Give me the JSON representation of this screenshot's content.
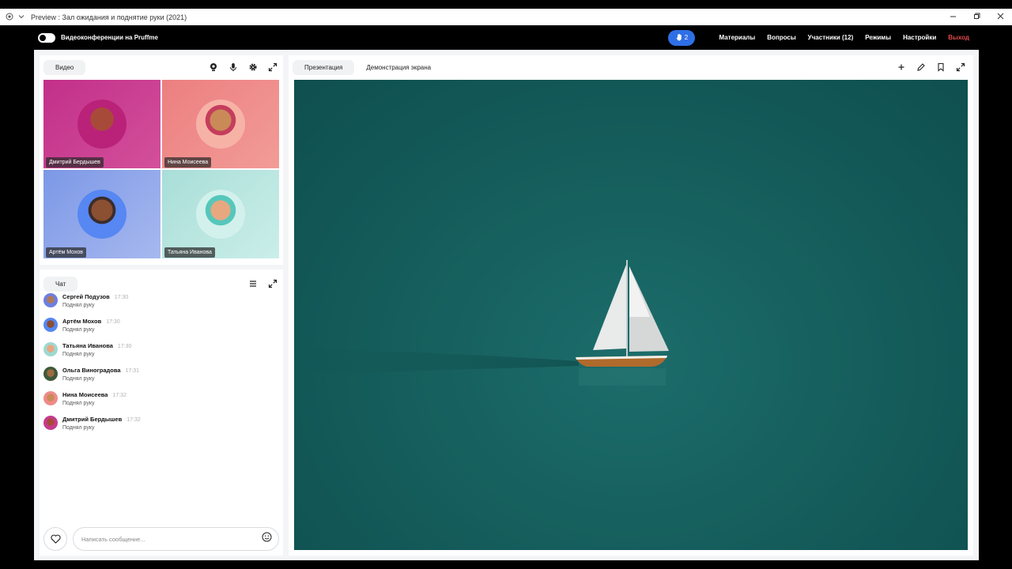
{
  "window": {
    "title": "Preview : Зал ожидания и поднятие руки (2021)"
  },
  "app": {
    "brand": "Видеоконференции на Pruffme",
    "hand_count": "2",
    "nav": {
      "materials": "Материалы",
      "questions": "Вопросы",
      "participants": "Участники (12)",
      "modes": "Режимы",
      "settings": "Настройки",
      "exit": "Выход"
    },
    "colors": {
      "accent": "#2f6fe6",
      "exit": "#e04848"
    }
  },
  "video": {
    "tab": "Видео",
    "tiles": [
      {
        "name": "Дмитрий Бердышев",
        "bg": "#c63a8e"
      },
      {
        "name": "Нина Моисеева",
        "bg": "#ef8a8a"
      },
      {
        "name": "Артём Мохов",
        "bg": "#8ba5ea"
      },
      {
        "name": "Татьяна Иванова",
        "bg": "#b9e4df"
      }
    ]
  },
  "chat": {
    "tab": "Чат",
    "messages": [
      {
        "author": "Сергей Подузов",
        "time": "17:30",
        "text": "Поднял руку"
      },
      {
        "author": "Артём Мохов",
        "time": "17:30",
        "text": "Поднял руку"
      },
      {
        "author": "Татьяна Иванова",
        "time": "17:30",
        "text": "Поднял руку"
      },
      {
        "author": "Ольга Виноградова",
        "time": "17:31",
        "text": "Поднял руку"
      },
      {
        "author": "Нина Моисеева",
        "time": "17:32",
        "text": "Поднял руку"
      },
      {
        "author": "Дмитрий Бердышев",
        "time": "17:32",
        "text": "Поднял руку"
      }
    ],
    "input_placeholder": "Написать сообщение..."
  },
  "presentation": {
    "tabs": [
      "Презентация",
      "Демонстрация экрана"
    ]
  }
}
